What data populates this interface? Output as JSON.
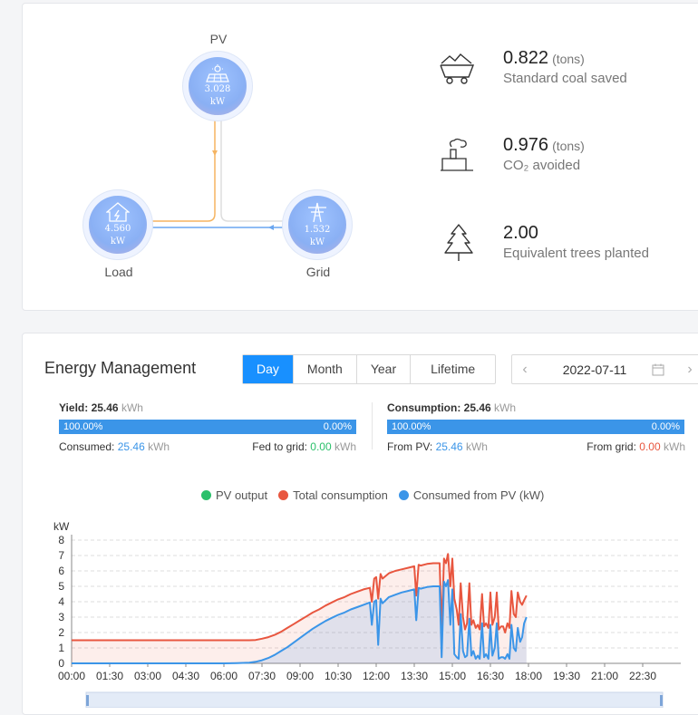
{
  "flow": {
    "pv": {
      "label": "PV",
      "value": "3.028",
      "unit": "kW"
    },
    "load": {
      "label": "Load",
      "value": "4.560",
      "unit": "kW"
    },
    "grid": {
      "label": "Grid",
      "value": "1.532",
      "unit": "kW"
    }
  },
  "stats": [
    {
      "value": "0.822",
      "unit": "(tons)",
      "desc": "Standard coal saved",
      "icon": "coal-cart-icon"
    },
    {
      "value": "0.976",
      "unit": "(tons)",
      "desc": "CO₂ avoided",
      "icon": "factory-icon"
    },
    {
      "value": "2.00",
      "unit": "",
      "desc": "Equivalent trees planted",
      "icon": "tree-icon"
    }
  ],
  "energy": {
    "title": "Energy Management",
    "tabs": [
      "Day",
      "Month",
      "Year",
      "Lifetime"
    ],
    "active_tab": "Day",
    "date": "2022-07-11",
    "yield": {
      "label": "Yield:",
      "value": "25.46",
      "unit": "kWh",
      "bar_left": "100.00%",
      "bar_right": "0.00%",
      "consumed_label": "Consumed:",
      "consumed_value": "25.46",
      "consumed_unit": "kWh",
      "fed_label": "Fed to grid:",
      "fed_value": "0.00",
      "fed_unit": "kWh"
    },
    "consumption": {
      "label": "Consumption:",
      "value": "25.46",
      "unit": "kWh",
      "bar_left": "100.00%",
      "bar_right": "0.00%",
      "frompv_label": "From PV:",
      "frompv_value": "25.46",
      "frompv_unit": "kWh",
      "fromgrid_label": "From grid:",
      "fromgrid_value": "0.00",
      "fromgrid_unit": "kWh"
    }
  },
  "colors": {
    "pv": "#2bc06b",
    "consumption": "#e8563f",
    "consumed_pv": "#3b95e8",
    "accent": "#1890ff"
  },
  "chart_data": {
    "type": "area",
    "ylabel": "kW",
    "ylim": [
      0,
      8
    ],
    "yticks": [
      0,
      1,
      2,
      3,
      4,
      5,
      6,
      7,
      8
    ],
    "xlim_hours": [
      0,
      24
    ],
    "xticks": [
      "00:00",
      "01:30",
      "03:00",
      "04:30",
      "06:00",
      "07:30",
      "09:00",
      "10:30",
      "12:00",
      "13:30",
      "15:00",
      "16:30",
      "18:00",
      "19:30",
      "21:00",
      "22:30"
    ],
    "legend": [
      "PV output",
      "Total consumption",
      "Consumed from PV (kW)"
    ],
    "series": [
      {
        "name": "Total consumption",
        "x": [
          0,
          1,
          2,
          3,
          4,
          5,
          6,
          6.5,
          7,
          7.25,
          7.5,
          7.75,
          8,
          8.25,
          8.5,
          8.75,
          9,
          9.25,
          9.5,
          9.75,
          10,
          10.25,
          10.5,
          10.75,
          11,
          11.25,
          11.5,
          11.75,
          11.83,
          11.92,
          12,
          12.08,
          12.17,
          12.25,
          12.5,
          12.75,
          13,
          13.25,
          13.5,
          13.58,
          13.67,
          13.75,
          14,
          14.25,
          14.5,
          14.58,
          14.67,
          14.75,
          14.83,
          14.92,
          15,
          15.08,
          15.17,
          15.25,
          15.33,
          15.42,
          15.5,
          15.58,
          15.67,
          15.75,
          15.83,
          15.92,
          16,
          16.08,
          16.17,
          16.25,
          16.33,
          16.42,
          16.5,
          16.58,
          16.67,
          16.75,
          16.83,
          16.92,
          17,
          17.08,
          17.17,
          17.25,
          17.33,
          17.42,
          17.5,
          17.58,
          17.67,
          17.75,
          17.83,
          17.92
        ],
        "y": [
          1.5,
          1.5,
          1.5,
          1.5,
          1.5,
          1.5,
          1.5,
          1.5,
          1.5,
          1.52,
          1.6,
          1.7,
          1.85,
          2.05,
          2.3,
          2.55,
          2.8,
          3.05,
          3.3,
          3.5,
          3.75,
          3.95,
          4.15,
          4.3,
          4.5,
          4.65,
          4.8,
          4.9,
          4.0,
          5.5,
          5.6,
          4.2,
          5.8,
          5.5,
          5.85,
          6.0,
          6.1,
          6.2,
          6.3,
          4.4,
          6.4,
          6.35,
          6.45,
          6.5,
          6.5,
          2.2,
          6.8,
          6.5,
          7.1,
          5.0,
          6.8,
          4.2,
          3.5,
          2.5,
          5.2,
          3.0,
          2.2,
          2.6,
          5.2,
          2.5,
          2.8,
          2.3,
          2.5,
          2.2,
          4.5,
          2.4,
          2.6,
          2.3,
          4.6,
          2.5,
          3.0,
          4.6,
          2.2,
          2.4,
          2.4,
          2.0,
          2.6,
          2.3,
          4.7,
          3.2,
          3.0,
          4.6,
          4.0,
          3.8,
          4.1,
          4.4
        ]
      },
      {
        "name": "Consumed from PV (kW)",
        "x": [
          0,
          1,
          2,
          3,
          4,
          5,
          6,
          6.5,
          7,
          7.25,
          7.5,
          7.75,
          8,
          8.25,
          8.5,
          8.75,
          9,
          9.25,
          9.5,
          9.75,
          10,
          10.25,
          10.5,
          10.75,
          11,
          11.25,
          11.5,
          11.75,
          11.83,
          11.92,
          12,
          12.08,
          12.17,
          12.25,
          12.5,
          12.75,
          13,
          13.25,
          13.5,
          13.58,
          13.67,
          13.75,
          14,
          14.25,
          14.5,
          14.58,
          14.67,
          14.75,
          14.83,
          14.92,
          15,
          15.08,
          15.17,
          15.25,
          15.33,
          15.42,
          15.5,
          15.58,
          15.67,
          15.75,
          15.83,
          15.92,
          16,
          16.08,
          16.17,
          16.25,
          16.33,
          16.42,
          16.5,
          16.58,
          16.67,
          16.75,
          16.83,
          16.92,
          17,
          17.08,
          17.17,
          17.25,
          17.33,
          17.42,
          17.5,
          17.58,
          17.67,
          17.75,
          17.83,
          17.92
        ],
        "y": [
          0,
          0,
          0,
          0,
          0,
          0,
          0,
          0.02,
          0.05,
          0.1,
          0.2,
          0.35,
          0.55,
          0.8,
          1.05,
          1.35,
          1.65,
          1.95,
          2.25,
          2.5,
          2.75,
          2.95,
          3.15,
          3.3,
          3.5,
          3.65,
          3.8,
          3.95,
          2.5,
          4.0,
          4.1,
          1.2,
          4.2,
          3.9,
          4.3,
          4.45,
          4.6,
          4.7,
          4.8,
          2.8,
          4.9,
          4.85,
          4.95,
          5.0,
          5.0,
          0.4,
          5.3,
          5.0,
          5.4,
          2.5,
          4.8,
          0.6,
          0.4,
          0.3,
          3.2,
          0.8,
          0.4,
          0.5,
          2.9,
          0.5,
          0.8,
          0.3,
          0.5,
          0.3,
          2.6,
          0.4,
          0.6,
          0.3,
          2.5,
          0.5,
          1.0,
          2.6,
          0.3,
          0.4,
          0.4,
          0.3,
          0.6,
          0.3,
          2.5,
          1.0,
          0.8,
          2.3,
          1.4,
          1.7,
          2.6,
          3.0
        ]
      }
    ]
  }
}
